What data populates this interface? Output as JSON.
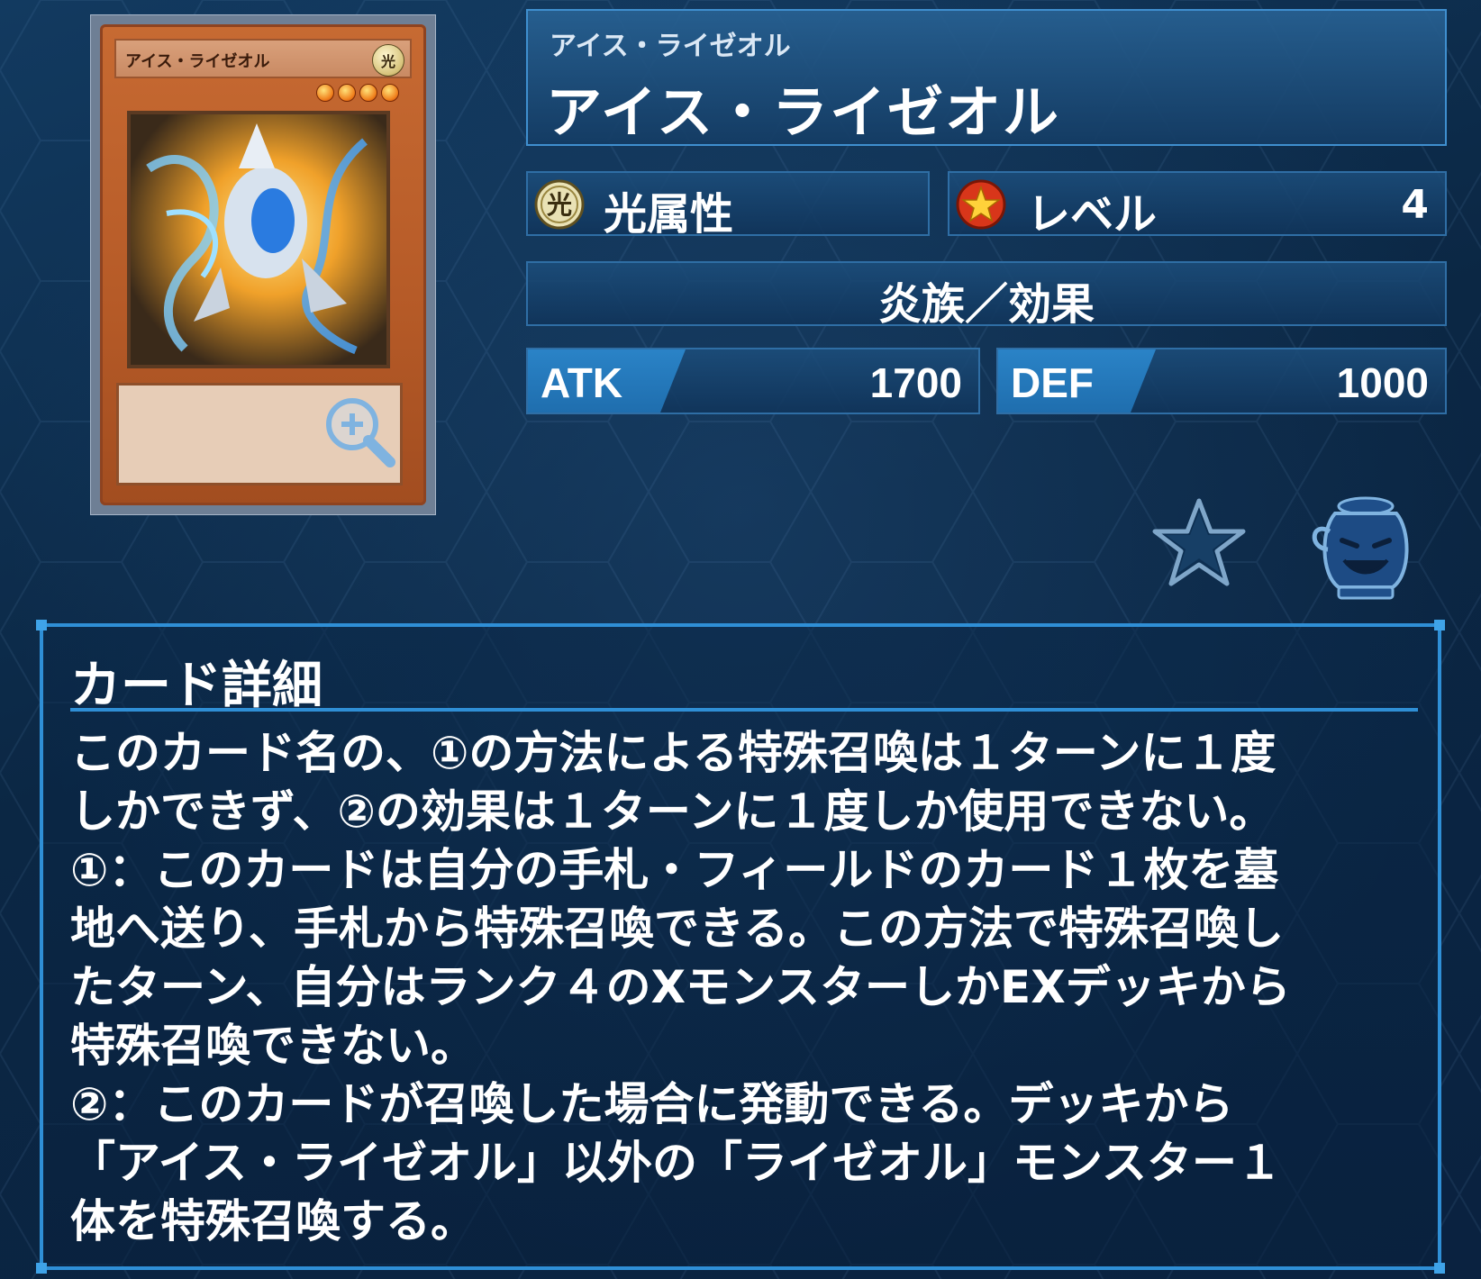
{
  "card": {
    "name_on_card": "アイス・ライゼオル",
    "attribute_glyph": "光",
    "level_stars": 4,
    "zoom_icon": "zoom-in-icon"
  },
  "header": {
    "ruby": "アイス・ライゼオル",
    "name": "アイス・ライゼオル"
  },
  "stats": {
    "attribute": {
      "icon": "light-attribute-icon",
      "glyph": "光",
      "label": "光属性"
    },
    "level": {
      "icon": "level-star-icon",
      "label": "レベル",
      "value": "4"
    },
    "race_type": "炎族／効果",
    "atk": {
      "label": "ATK",
      "value": "1700"
    },
    "def": {
      "label": "DEF",
      "value": "1000"
    }
  },
  "actions": {
    "favorite_icon": "star-icon",
    "pot_icon": "pot-of-greed-icon"
  },
  "detail": {
    "heading": "カード詳細",
    "text": "このカード名の、①の方法による特殊召喚は１ターンに１度\nしかできず、②の効果は１ターンに１度しか使用できない。\n①：このカードは自分の手札・フィールドのカード１枚を墓\n地へ送り、手札から特殊召喚できる。この方法で特殊召喚し\nたターン、自分はランク４のXモンスターしかEXデッキから\n特殊召喚できない。\n②：このカードが召喚した場合に発動できる。デッキから\n「アイス・ライゼオル」以外の「ライゼオル」モンスター１\n体を特殊召喚する。"
  },
  "colors": {
    "background": "#0b2744",
    "panel_border": "#2f8fd6",
    "stat_tag": "#2a83c7"
  }
}
